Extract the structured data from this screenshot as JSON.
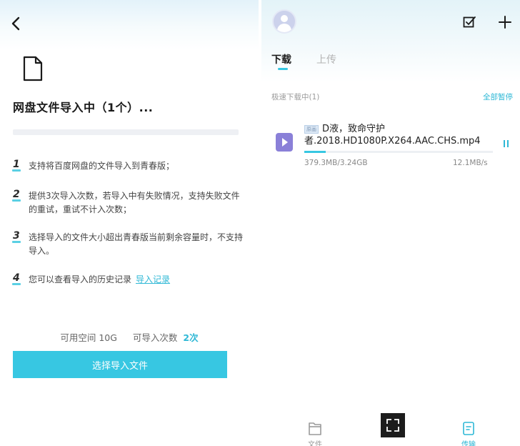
{
  "left": {
    "title": "网盘文件导入中（1个）...",
    "tips": [
      {
        "num": "1",
        "text": "支持将百度网盘的文件导入到青春版；"
      },
      {
        "num": "2",
        "text": "提供3次导入次数，若导入中有失败情况，支持失败文件的重试，重试不计入次数；"
      },
      {
        "num": "3",
        "text": "选择导入的文件大小超出青春版当前剩余容量时，不支持导入。"
      },
      {
        "num": "4",
        "text": "您可以查看导入的历史记录",
        "link": "导入记录"
      }
    ],
    "space_label": "可用空间 10G",
    "count_label": "可导入次数",
    "count_value": "2次",
    "select_button": "选择导入文件"
  },
  "right": {
    "tabs": {
      "download": "下载",
      "upload": "上传"
    },
    "section_label": "极速下载中(1)",
    "pause_all": "全部暂停",
    "item": {
      "tag": "原画",
      "name": "D液，致命守护者.2018.HD1080P.X264.AAC.CHS.mp4",
      "size": "379.3MB/3.24GB",
      "speed": "12.1MB/s",
      "progress": 0.114
    },
    "nav": {
      "file_label": "文件",
      "transfer_label": "传输"
    }
  },
  "colors": {
    "accent": "#37c7e2",
    "link": "#2fb8d6",
    "video_icon": "#8a80d8"
  },
  "icons": {
    "back": "chevron-left-icon",
    "file": "document-icon",
    "check": "checkbox-icon",
    "add": "plus-icon",
    "pause": "pause-icon",
    "nav_file": "folder-icon",
    "nav_transfer": "transfer-icon",
    "nav_center": "expand-icon"
  }
}
